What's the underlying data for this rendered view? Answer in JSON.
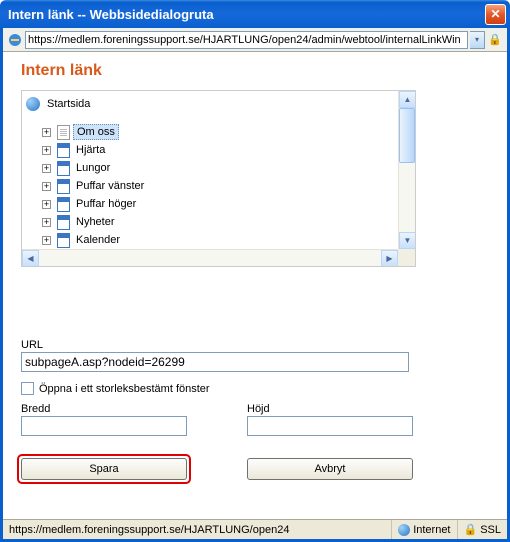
{
  "window": {
    "title": "Intern länk -- Webbsidedialogruta",
    "close_symbol": "✕"
  },
  "address_bar": {
    "url": "https://medlem.foreningssupport.se/HJARTLUNG/open24/admin/webtool/internalLinkWin",
    "drop_symbol": "▾",
    "lock_symbol": "🔒"
  },
  "page": {
    "heading": "Intern länk",
    "root_label": "Startsida",
    "tree_items": [
      {
        "label": "Om oss",
        "selected": true,
        "icon": "doc"
      },
      {
        "label": "Hjärta",
        "selected": false,
        "icon": "blue"
      },
      {
        "label": "Lungor",
        "selected": false,
        "icon": "blue"
      },
      {
        "label": "Puffar vänster",
        "selected": false,
        "icon": "blue"
      },
      {
        "label": "Puffar höger",
        "selected": false,
        "icon": "blue"
      },
      {
        "label": "Nyheter",
        "selected": false,
        "icon": "blue"
      },
      {
        "label": "Kalender",
        "selected": false,
        "icon": "blue"
      }
    ],
    "expander_symbol": "+"
  },
  "scroll": {
    "up": "▲",
    "down": "▼",
    "left": "◀",
    "right": "▶"
  },
  "form": {
    "url_label": "URL",
    "url_value": "subpageA.asp?nodeid=26299",
    "open_sized_label": "Öppna i ett storleksbestämt fönster",
    "width_label": "Bredd",
    "height_label": "Höjd",
    "width_value": "",
    "height_value": "",
    "save_label": "Spara",
    "cancel_label": "Avbryt"
  },
  "status": {
    "path": "https://medlem.foreningssupport.se/HJARTLUNG/open24",
    "zone": "Internet",
    "ssl": "SSL",
    "lock_symbol": "🔒"
  }
}
